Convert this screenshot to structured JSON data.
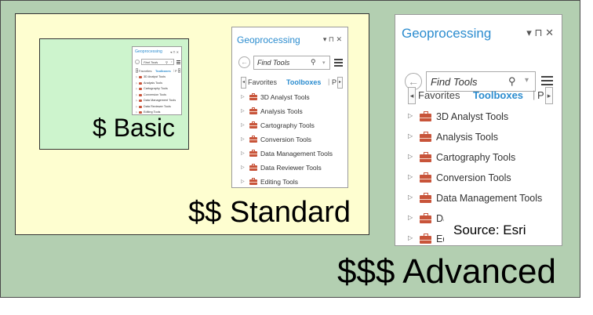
{
  "tiers": {
    "basic": "$ Basic",
    "standard": "$$ Standard",
    "advanced": "$$$ Advanced"
  },
  "pane": {
    "title": "Geoprocessing",
    "controls": "▾ ⊓ ✕",
    "search_placeholder": "Find Tools",
    "tabs": {
      "favorites": "Favorites",
      "toolboxes": "Toolboxes",
      "next_tab_partial": "P"
    },
    "toolboxes": [
      "3D Analyst Tools",
      "Analysis Tools",
      "Cartography Tools",
      "Conversion Tools",
      "Data Management Tools",
      "Data Reviewer Tools",
      "Editing Tools"
    ]
  },
  "source": "Source: Esri",
  "colors": {
    "advanced_bg": "#b3cfb1",
    "standard_bg": "#fefed0",
    "basic_bg": "#cdf4cd",
    "accent": "#2b8ccf",
    "toolbox_icon": "#c8543a"
  },
  "icons": [
    "back-arrow-icon",
    "search-icon",
    "dropdown-icon",
    "hamburger-menu-icon",
    "toolbox-icon",
    "expand-triangle-icon",
    "pin-icon",
    "close-icon"
  ]
}
